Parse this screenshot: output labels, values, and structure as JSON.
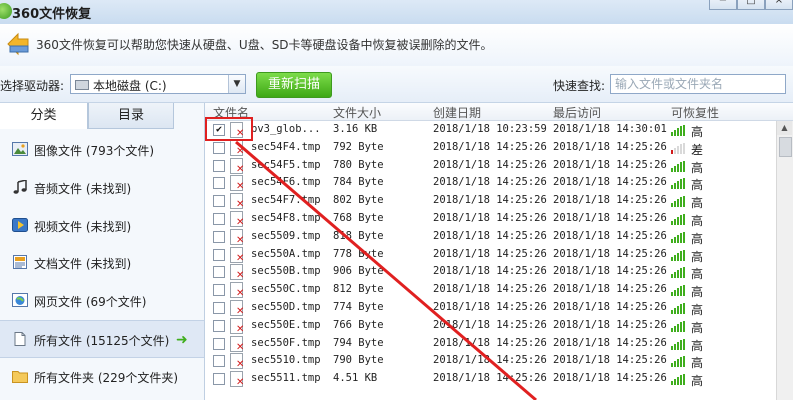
{
  "window": {
    "title": "360文件恢复"
  },
  "header": {
    "description": "360文件恢复可以帮助您快速从硬盘、U盘、SD卡等硬盘设备中恢复被误删除的文件。"
  },
  "toolbar": {
    "drive_label": "选择驱动器:",
    "drive_value": "本地磁盘 (C:)",
    "rescan_label": "重新扫描",
    "search_label": "快速查找:",
    "search_placeholder": "输入文件或文件夹名"
  },
  "tabs": [
    {
      "label": "分类"
    },
    {
      "label": "目录"
    }
  ],
  "categories": [
    {
      "label": "图像文件 (793个文件)",
      "icon": "image-icon"
    },
    {
      "label": "音频文件 (未找到)",
      "icon": "music-icon"
    },
    {
      "label": "视频文件 (未找到)",
      "icon": "video-icon"
    },
    {
      "label": "文档文件 (未找到)",
      "icon": "document-icon"
    },
    {
      "label": "网页文件 (69个文件)",
      "icon": "web-icon"
    },
    {
      "label": "所有文件 (15125个文件)",
      "icon": "file-icon",
      "selected": true
    },
    {
      "label": "所有文件夹 (229个文件夹)",
      "icon": "folder-icon"
    }
  ],
  "table": {
    "columns": [
      "文件名",
      "文件大小",
      "创建日期",
      "最后访问",
      "可恢复性"
    ],
    "rows": [
      {
        "checked": true,
        "name": "pv3_glob...",
        "size": "3.16 KB",
        "created": "2018/1/18 10:23:59",
        "accessed": "2018/1/18 14:30:01",
        "recover": "高",
        "quality": "good"
      },
      {
        "checked": false,
        "name": "sec54F4.tmp",
        "size": "792 Byte",
        "created": "2018/1/18 14:25:26",
        "accessed": "2018/1/18 14:25:26",
        "recover": "差",
        "quality": "bad"
      },
      {
        "checked": false,
        "name": "sec54F5.tmp",
        "size": "780 Byte",
        "created": "2018/1/18 14:25:26",
        "accessed": "2018/1/18 14:25:26",
        "recover": "高",
        "quality": "good"
      },
      {
        "checked": false,
        "name": "sec54F6.tmp",
        "size": "784 Byte",
        "created": "2018/1/18 14:25:26",
        "accessed": "2018/1/18 14:25:26",
        "recover": "高",
        "quality": "good"
      },
      {
        "checked": false,
        "name": "sec54F7.tmp",
        "size": "802 Byte",
        "created": "2018/1/18 14:25:26",
        "accessed": "2018/1/18 14:25:26",
        "recover": "高",
        "quality": "good"
      },
      {
        "checked": false,
        "name": "sec54F8.tmp",
        "size": "768 Byte",
        "created": "2018/1/18 14:25:26",
        "accessed": "2018/1/18 14:25:26",
        "recover": "高",
        "quality": "good"
      },
      {
        "checked": false,
        "name": "sec5509.tmp",
        "size": "818 Byte",
        "created": "2018/1/18 14:25:26",
        "accessed": "2018/1/18 14:25:26",
        "recover": "高",
        "quality": "good"
      },
      {
        "checked": false,
        "name": "sec550A.tmp",
        "size": "778 Byte",
        "created": "2018/1/18 14:25:26",
        "accessed": "2018/1/18 14:25:26",
        "recover": "高",
        "quality": "good"
      },
      {
        "checked": false,
        "name": "sec550B.tmp",
        "size": "906 Byte",
        "created": "2018/1/18 14:25:26",
        "accessed": "2018/1/18 14:25:26",
        "recover": "高",
        "quality": "good"
      },
      {
        "checked": false,
        "name": "sec550C.tmp",
        "size": "812 Byte",
        "created": "2018/1/18 14:25:26",
        "accessed": "2018/1/18 14:25:26",
        "recover": "高",
        "quality": "good"
      },
      {
        "checked": false,
        "name": "sec550D.tmp",
        "size": "774 Byte",
        "created": "2018/1/18 14:25:26",
        "accessed": "2018/1/18 14:25:26",
        "recover": "高",
        "quality": "good"
      },
      {
        "checked": false,
        "name": "sec550E.tmp",
        "size": "766 Byte",
        "created": "2018/1/18 14:25:26",
        "accessed": "2018/1/18 14:25:26",
        "recover": "高",
        "quality": "good"
      },
      {
        "checked": false,
        "name": "sec550F.tmp",
        "size": "794 Byte",
        "created": "2018/1/18 14:25:26",
        "accessed": "2018/1/18 14:25:26",
        "recover": "高",
        "quality": "good"
      },
      {
        "checked": false,
        "name": "sec5510.tmp",
        "size": "790 Byte",
        "created": "2018/1/18 14:25:26",
        "accessed": "2018/1/18 14:25:26",
        "recover": "高",
        "quality": "good"
      },
      {
        "checked": false,
        "name": "sec5511.tmp",
        "size": "4.51 KB",
        "created": "2018/1/18 14:25:26",
        "accessed": "2018/1/18 14:25:26",
        "recover": "高",
        "quality": "good"
      }
    ]
  },
  "colors": {
    "accent_green": "#3fae1d",
    "highlight_red": "#e02020",
    "delete_mark": "#d21a1a"
  }
}
